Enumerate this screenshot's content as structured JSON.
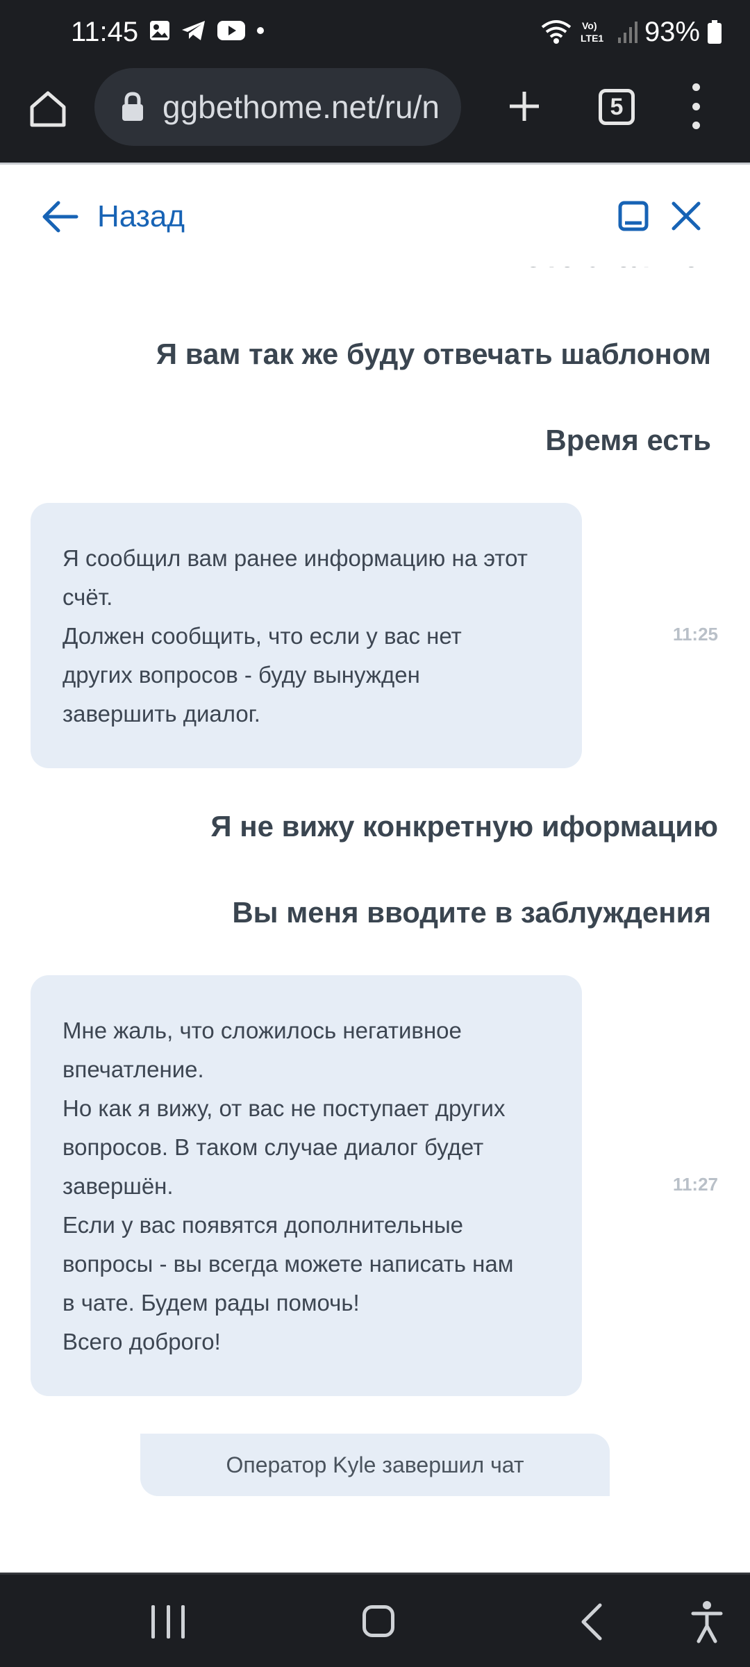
{
  "status_bar": {
    "time": "11:45",
    "network_label": "Vo) LTE1",
    "battery": "93%",
    "notification_icons": [
      "gallery-icon",
      "telegram-icon",
      "youtube-icon",
      "dot-icon"
    ]
  },
  "browser": {
    "url": "ggbethome.net/ru/n",
    "tab_count": "5"
  },
  "chat_header": {
    "back_label": "Назад"
  },
  "chat": {
    "partial_top": "Это сколько?",
    "messages": [
      {
        "type": "user",
        "text": "Я вам так же буду отвечать шаблоном"
      },
      {
        "type": "user",
        "text": "Время есть"
      },
      {
        "type": "operator",
        "lines": [
          "Я сообщил вам ранее информацию на этот",
          "счёт.",
          "Должен сообщить, что если у вас нет",
          "других вопросов - буду вынужден",
          "завершить диалог."
        ],
        "time": "11:25"
      },
      {
        "type": "user",
        "text": "Я не вижу конкретную иформацию"
      },
      {
        "type": "user",
        "text": "Вы меня вводите в заблуждения"
      },
      {
        "type": "operator",
        "lines": [
          "Мне жаль, что сложилось негативное",
          "впечатление.",
          "Но как я вижу, от вас не поступает других",
          "вопросов. В таком случае диалог будет",
          "завершён.",
          "Если у вас появятся дополнительные",
          "вопросы - вы всегда можете написать нам",
          "в чате. Будем рады помочь!",
          "Всего доброго!"
        ],
        "time": "11:27"
      },
      {
        "type": "system",
        "text": "Оператор Kyle завершил чат"
      }
    ]
  },
  "colors": {
    "accent": "#1763b5",
    "bubble": "#e6edf6",
    "user_text": "#3a4550",
    "dark_bar": "#1c1e22"
  }
}
